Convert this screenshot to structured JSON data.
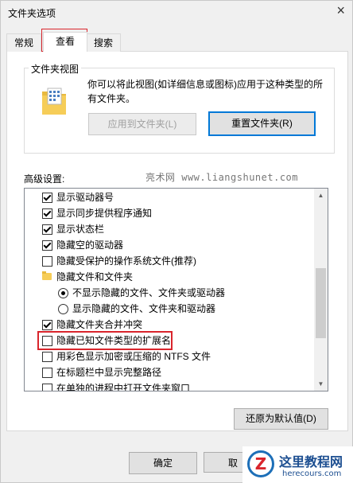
{
  "window": {
    "title": "文件夹选项",
    "close_glyph": "×"
  },
  "tabs": [
    {
      "label": "常规"
    },
    {
      "label": "查看",
      "selected": true
    },
    {
      "label": "搜索"
    }
  ],
  "folder_views": {
    "title": "文件夹视图",
    "description": "你可以将此视图(如详细信息或图标)应用于这种类型的所有文件夹。",
    "apply_button": "应用到文件夹(L)",
    "reset_button": "重置文件夹(R)"
  },
  "advanced": {
    "label": "高级设置:",
    "watermark": "亮术网 www.liangshunet.com",
    "items": [
      {
        "label": "显示驱动器号",
        "type": "checkbox",
        "checked": true
      },
      {
        "label": "显示同步提供程序通知",
        "type": "checkbox",
        "checked": true
      },
      {
        "label": "显示状态栏",
        "type": "checkbox",
        "checked": true
      },
      {
        "label": "隐藏空的驱动器",
        "type": "checkbox",
        "checked": true
      },
      {
        "label": "隐藏受保护的操作系统文件(推荐)",
        "type": "checkbox",
        "checked": false
      },
      {
        "label": "隐藏文件和文件夹",
        "type": "folder"
      },
      {
        "label": "不显示隐藏的文件、文件夹或驱动器",
        "type": "radio",
        "checked": true
      },
      {
        "label": "显示隐藏的文件、文件夹和驱动器",
        "type": "radio",
        "checked": false
      },
      {
        "label": "隐藏文件夹合并冲突",
        "type": "checkbox",
        "checked": true
      },
      {
        "label": "隐藏已知文件类型的扩展名",
        "type": "checkbox",
        "checked": false,
        "highlighted": true
      },
      {
        "label": "用彩色显示加密或压缩的 NTFS 文件",
        "type": "checkbox",
        "checked": false
      },
      {
        "label": "在标题栏中显示完整路径",
        "type": "checkbox",
        "checked": false
      },
      {
        "label": "在单独的进程中打开文件夹窗口",
        "type": "checkbox",
        "checked": false
      }
    ],
    "restore_button": "还原为默认值(D)"
  },
  "footer": {
    "ok_button": "确定",
    "cancel_button_partial": "取"
  },
  "logo": {
    "title": "这里教程网",
    "subtitle": "herecours.com"
  },
  "colors": {
    "highlight": "#d9252c",
    "primary_border": "#0078d7",
    "folder_yellow": "#f6cd58"
  }
}
